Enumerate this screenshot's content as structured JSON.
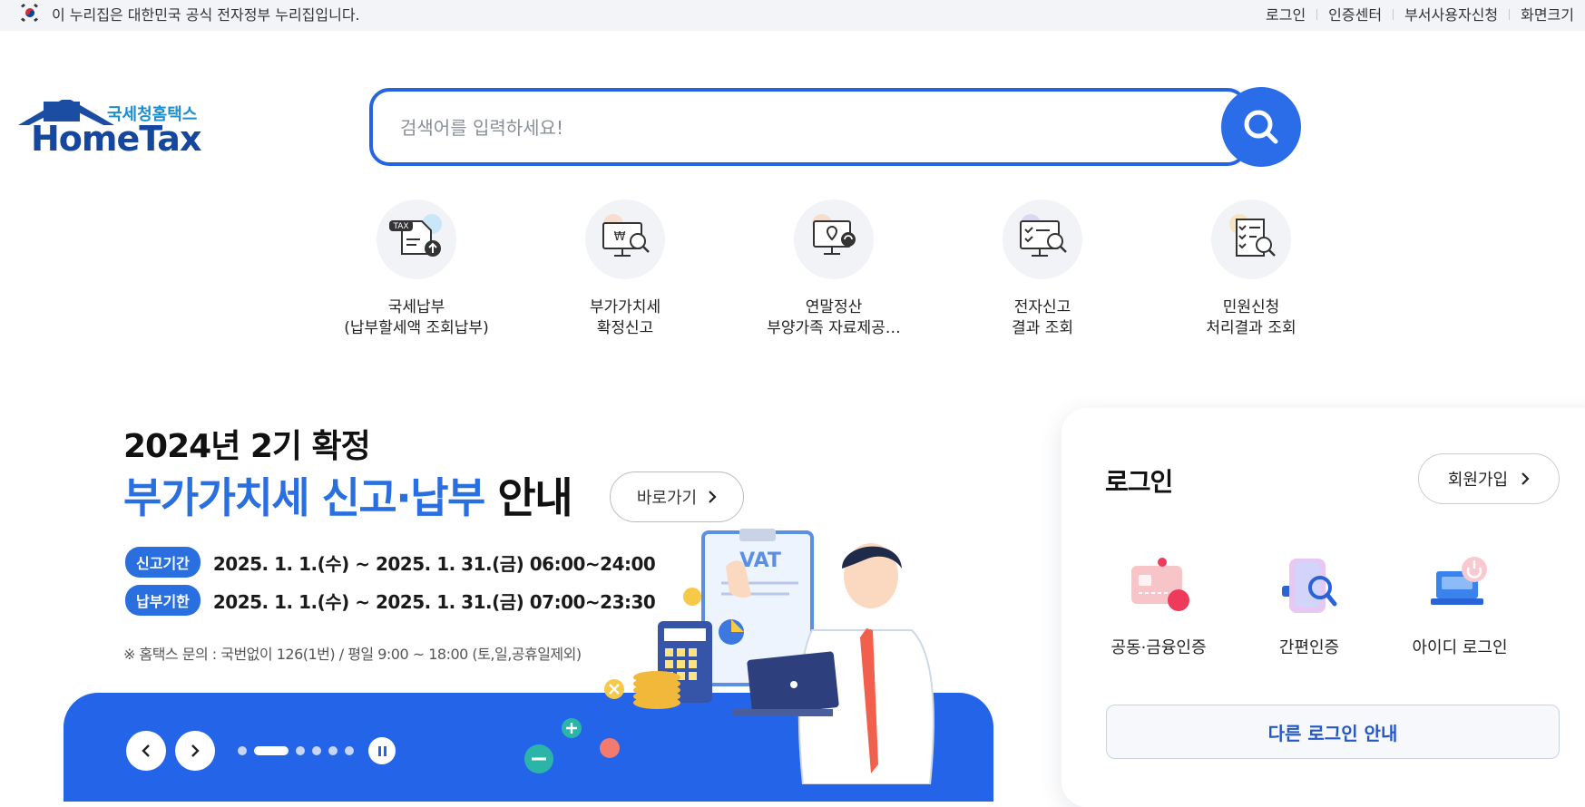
{
  "topbar": {
    "gov_notice": "이 누리집은 대한민국 공식 전자정부 누리집입니다.",
    "links": [
      "로그인",
      "인증센터",
      "부서사용자신청",
      "화면크기"
    ]
  },
  "logo": {
    "sub": "국세청홈택스",
    "main": "HomeTax"
  },
  "search": {
    "placeholder": "검색어를 입력하세요!"
  },
  "quick_menu": [
    {
      "line1": "국세납부",
      "line2": "(납부할세액 조회납부)",
      "icon": "tax-upload-icon"
    },
    {
      "line1": "부가가치세",
      "line2": "확정신고",
      "icon": "monitor-won-search-icon"
    },
    {
      "line1": "연말정산",
      "line2": "부양가족 자료제공…",
      "icon": "monitor-location-icon"
    },
    {
      "line1": "전자신고",
      "line2": "결과 조회",
      "icon": "monitor-check-search-icon"
    },
    {
      "line1": "민원신청",
      "line2": "처리결과 조회",
      "icon": "document-check-search-icon"
    }
  ],
  "banner": {
    "title1": "2024년 2기 확정",
    "title2_blue": "부가가치세 신고·납부",
    "title2_black": "안내",
    "goto_label": "바로가기",
    "rows": [
      {
        "badge": "신고기간",
        "text": "2025. 1. 1.(수) ~ 2025. 1. 31.(금) 06:00~24:00"
      },
      {
        "badge": "납부기한",
        "text": "2025. 1. 1.(수) ~ 2025. 1. 31.(금) 07:00~23:30"
      }
    ],
    "note": "※ 홈택스 문의 : 국번없이 126(1번) / 평일 9:00 ~ 18:00 (토,일,공휴일제외)",
    "vat_label": "VAT",
    "slide_count": 6,
    "active_slide": 2
  },
  "login": {
    "title": "로그인",
    "join_label": "회원가입",
    "options": [
      "공동·금융인증",
      "간편인증",
      "아이디 로그인"
    ],
    "other_label": "다른 로그인 안내"
  },
  "colors": {
    "primary": "#2b6de8",
    "logo_navy": "#15479e",
    "logo_sub": "#1a8ecf"
  }
}
